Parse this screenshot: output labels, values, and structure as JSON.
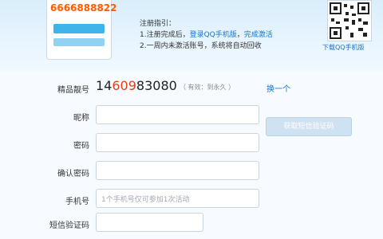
{
  "header": {
    "phone_number": "6666888822",
    "banner_title": "",
    "guide_title": "注册指引：",
    "step1_prefix": "1.注册完成后，",
    "step1_link1": "登录QQ手机版",
    "step1_sep": "，",
    "step1_link2": "完成激活",
    "step2": "2.一周内未激活账号，系统将自动回收",
    "qr_caption": "下载QQ手机版"
  },
  "form": {
    "premium_label": "精品靓号",
    "number_prefix": "14",
    "number_highlight": "609",
    "number_suffix": "83080",
    "expire_note": "（ 有效：到永久 ）",
    "change_link": "换一个",
    "nickname_label": "昵称",
    "password_label": "密码",
    "confirm_label": "确认密码",
    "phone_label": "手机号",
    "phone_placeholder": "1个手机号仅可参加1次活动",
    "sms_button": "获取短信验证码",
    "sms_label": "短信验证码"
  }
}
